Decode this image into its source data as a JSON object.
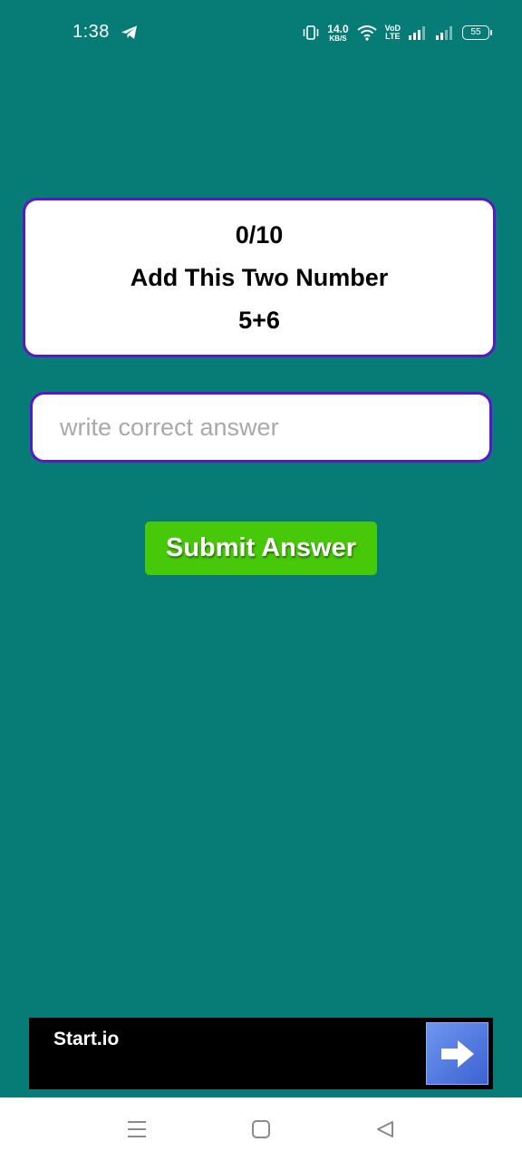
{
  "status_bar": {
    "time": "1:38",
    "net_speed_value": "14.0",
    "net_speed_unit": "KB/S",
    "volte_top": "VoD",
    "volte_bottom": "LTE",
    "battery": "55",
    "icons": [
      "telegram-icon",
      "vibrate-icon",
      "wifi-icon",
      "signal-icon",
      "signal-icon"
    ]
  },
  "quiz": {
    "progress": "0/10",
    "instruction": "Add This Two Number",
    "question": "5+6"
  },
  "answer": {
    "placeholder": "write correct answer",
    "value": ""
  },
  "submit": {
    "label": "Submit Answer"
  },
  "ad": {
    "brand": "Start.io",
    "arrow_icon": "arrow-right-icon"
  },
  "nav": {
    "icons": [
      "menu-icon",
      "home-icon",
      "back-icon"
    ]
  },
  "colors": {
    "background": "#077c76",
    "card_border": "#5a17c9",
    "submit_bg": "#47c90a",
    "ad_bg": "#000000"
  }
}
